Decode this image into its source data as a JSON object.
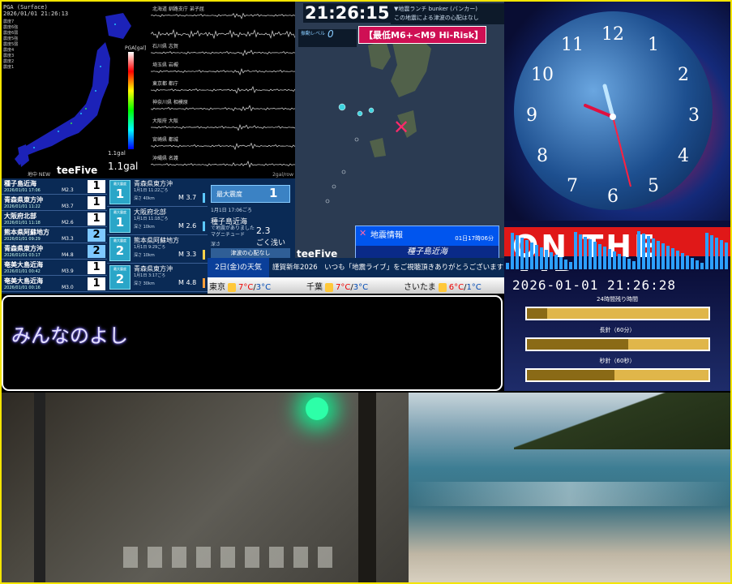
{
  "pga": {
    "title": "PGA (Surface)",
    "timestamp": "2026/01/01 21:26:13",
    "legend": [
      "震度7",
      "震度6強",
      "震度6弱",
      "震度5強",
      "震度5弱",
      "震度4",
      "震度3",
      "震度2",
      "震度1"
    ],
    "scale_label": "PGA[gal]",
    "gal_small": "1.1gal",
    "gal_big": "1.1gal",
    "source": "地中 NEW",
    "brand": "teeFive"
  },
  "waveforms": {
    "stations": [
      "北海道 釧路支庁 弟子屈",
      "",
      "石川県 志賀",
      "埼玉県 岩槻",
      "東京都 都庁",
      "神奈川県 相模原",
      "大阪府 大阪",
      "宮崎県 都城",
      "沖縄県 名護"
    ],
    "unit": "2gal/row"
  },
  "quake_list": [
    {
      "name": "種子島近海",
      "time": "2026/01/01 17:06",
      "mag": "M2.3",
      "intensity": "1",
      "color": "#ffffff"
    },
    {
      "name": "青森県東方沖",
      "time": "2026/01/01 11:22",
      "mag": "M3.7",
      "intensity": "1",
      "color": "#ffffff"
    },
    {
      "name": "大阪府北部",
      "time": "2026/01/01 11:18",
      "mag": "M2.6",
      "intensity": "1",
      "color": "#ffffff"
    },
    {
      "name": "熊本県阿蘇地方",
      "time": "2026/01/01 09:29",
      "mag": "M3.3",
      "intensity": "2",
      "color": "#7ec8ff"
    },
    {
      "name": "青森県東方沖",
      "time": "2026/01/01 03:17",
      "mag": "M4.8",
      "intensity": "2",
      "color": "#7ec8ff"
    },
    {
      "name": "奄美大島近海",
      "time": "2026/01/01 00:42",
      "mag": "M3.9",
      "intensity": "1",
      "color": "#ffffff"
    },
    {
      "name": "奄美大島近海",
      "time": "2026/01/01 00:16",
      "mag": "M3.0",
      "intensity": "1",
      "color": "#ffffff"
    }
  ],
  "detail_list": [
    {
      "cap": "最大震度",
      "intensity": "1",
      "name": "青森県東方沖",
      "date": "1月1日 11:22ごろ",
      "depth": "深さ 40km",
      "mag": "M 3.7",
      "bar": "#5cc8ff"
    },
    {
      "cap": "最大震度",
      "intensity": "1",
      "name": "大阪府北部",
      "date": "1月1日 11:18ごろ",
      "depth": "深さ 10km",
      "mag": "M 2.6",
      "bar": "#5cc8ff"
    },
    {
      "cap": "最大震度",
      "intensity": "2",
      "name": "熊本県阿蘇地方",
      "date": "1月1日 9:29ごろ",
      "depth": "深さ 10km",
      "mag": "M 3.3",
      "bar": "#ffd24a"
    },
    {
      "cap": "最大震度",
      "intensity": "2",
      "name": "青森県東方沖",
      "date": "1月1日 3:17ごろ",
      "depth": "深さ 30km",
      "mag": "M 4.8",
      "bar": "#ff9f3a"
    }
  ],
  "info": {
    "max_label": "最大震度",
    "max_value": "1",
    "date": "1月1日 17:06ごろ",
    "location": "種子島近海",
    "note": "で地震がありました",
    "mag_label": "マグニチュード",
    "mag_value": "2.3",
    "depth_label": "深さ",
    "depth_value": "ごく浅い",
    "tsunami": "津波の心配なし"
  },
  "map": {
    "clock": "21:26:15",
    "level_label": "振動レベル",
    "level_value": "0",
    "ticker1": "▼地震ランチ bunker (バンカー)",
    "ticker2": "この地震による津波の心配はなし",
    "risk": "【最低M6+<M9 Hi-Risk】",
    "brand": "teeFive",
    "quake_title": "地震情報",
    "quake_time": "01日17時06分",
    "quake_location": "種子島近海"
  },
  "banner": {
    "date": "2日(金)の天気",
    "message": "謹賀新年2026　いつも「地震ライブ」をご視聴頂きありがとうございます!"
  },
  "weather": [
    {
      "city": "東京",
      "hi": "7°C",
      "lo": "3°C"
    },
    {
      "city": "千葉",
      "hi": "7°C",
      "lo": "3°C"
    },
    {
      "city": "さいたま",
      "hi": "6°C",
      "lo": "1°C"
    }
  ],
  "clock_panel": {
    "numbers": [
      "12",
      "1",
      "2",
      "3",
      "4",
      "5",
      "6",
      "7",
      "8",
      "9",
      "10",
      "11"
    ]
  },
  "onair": {
    "text": "ON THE AIR"
  },
  "timer": {
    "timestamp": "2026-01-01 21:26:28",
    "label1": "24時間残り時間",
    "label2": "長針（60分）",
    "label3": "秒針（60秒）",
    "progress1": 0.11,
    "progress2": 0.56,
    "progress3": 0.48
  },
  "chat": {
    "text": "みんなのよし"
  },
  "colors": {
    "frame": "#f4e500",
    "panel_blue": "#0a2a55",
    "risk_red": "#cf0f54",
    "onair_red": "#e01818"
  }
}
